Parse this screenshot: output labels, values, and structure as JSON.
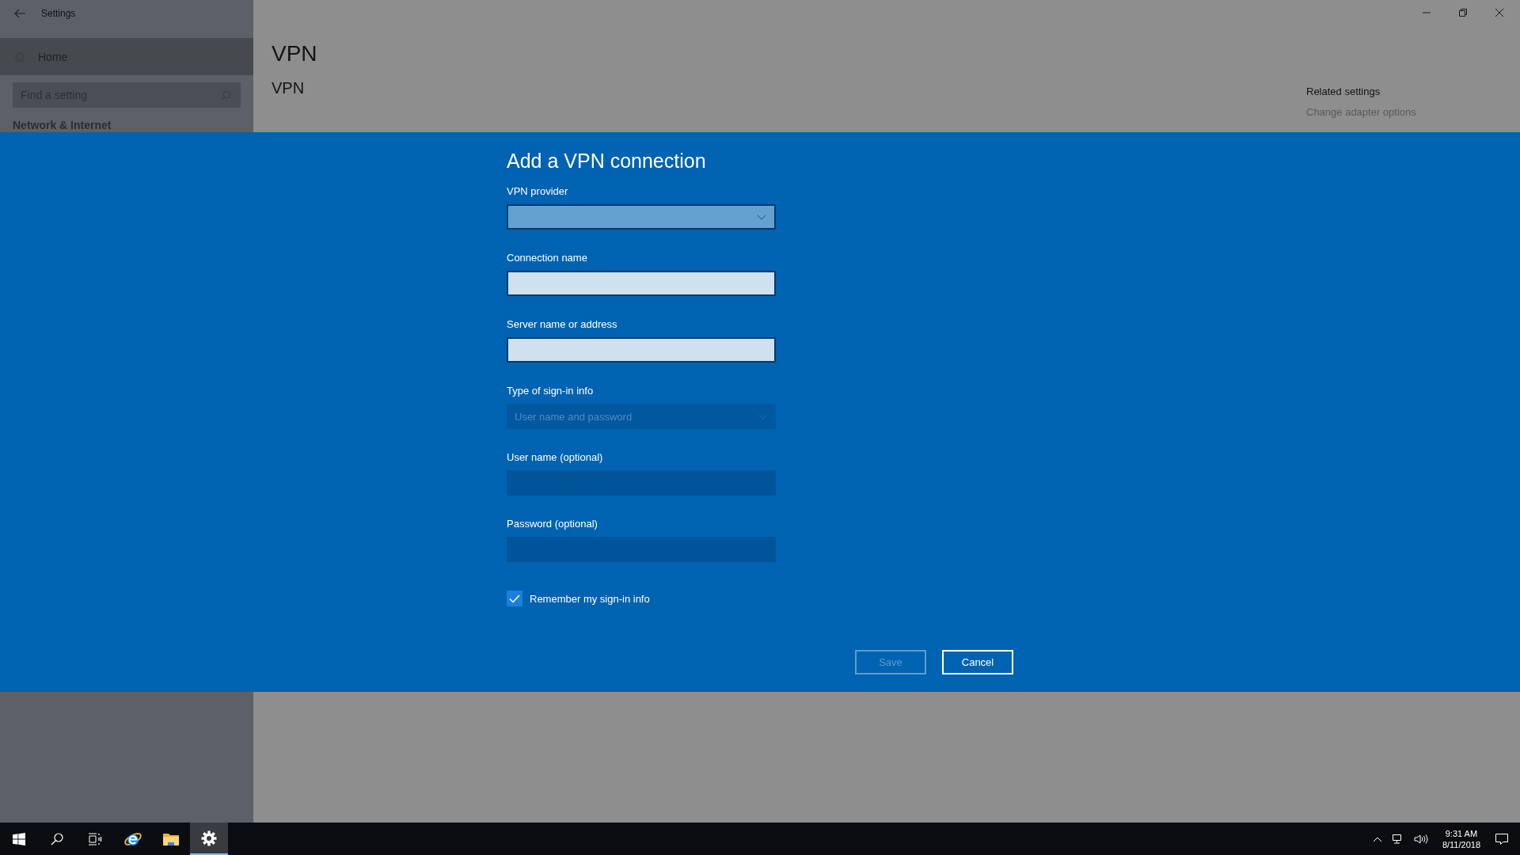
{
  "window": {
    "title": "Settings"
  },
  "sidebar": {
    "home": "Home",
    "search": {
      "placeholder": "Find a setting"
    },
    "section": "Network & Internet"
  },
  "page": {
    "title": "VPN",
    "subtitle": "VPN"
  },
  "related": {
    "title": "Related settings",
    "links": [
      "Change adapter options"
    ]
  },
  "dialog": {
    "title": "Add a VPN connection",
    "fields": [
      {
        "kind": "dropdown",
        "label": "VPN provider",
        "disabled": false
      },
      {
        "kind": "text",
        "label": "Connection name",
        "disabled": false
      },
      {
        "kind": "text",
        "label": "Server name or address",
        "disabled": false
      },
      {
        "kind": "dropdown",
        "label": "Type of sign-in info",
        "value": "User name and password",
        "disabled": true
      },
      {
        "kind": "text",
        "label": "User name (optional)",
        "disabled": true
      },
      {
        "kind": "password",
        "label": "Password (optional)",
        "disabled": true
      }
    ],
    "checkbox": {
      "label": "Remember my sign-in info",
      "checked": true
    },
    "buttons": [
      {
        "label": "Save",
        "disabled": true
      },
      {
        "label": "Cancel",
        "disabled": false
      }
    ]
  },
  "taskbar": {
    "apps": [
      {
        "kind": "start",
        "selected": false
      },
      {
        "kind": "search",
        "selected": false
      },
      {
        "kind": "taskview",
        "selected": false
      },
      {
        "kind": "browser",
        "selected": false
      },
      {
        "kind": "folder",
        "selected": false
      },
      {
        "kind": "settings",
        "selected": true
      }
    ],
    "clock": {
      "time": "9:31 AM",
      "date": "8/11/2018"
    }
  }
}
